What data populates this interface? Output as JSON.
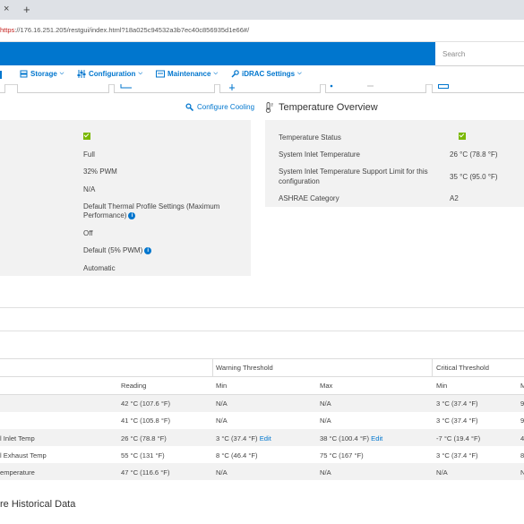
{
  "browser": {
    "tab_close": "×",
    "new_tab": "+",
    "url_protocol": "https",
    "url_rest": "://176.16.251.205/restgui/index.html?18a025c94532a3b7ec40c856935d1e66#/"
  },
  "header": {
    "search_placeholder": "Search"
  },
  "nav": {
    "items": [
      {
        "label": "Storage"
      },
      {
        "label": "Configuration"
      },
      {
        "label": "Maintenance"
      },
      {
        "label": "iDRAC Settings"
      }
    ]
  },
  "cooling": {
    "configure_label": "Configure Cooling",
    "values": {
      "status": "",
      "fan_speed": "Full",
      "pwm": "32% PWM",
      "na": "N/A",
      "profile_line1": "Default Thermal Profile Settings (Maximum",
      "profile_line2": "Performance)",
      "off": "Off",
      "default_pwm": "Default (5% PWM)",
      "automatic": "Automatic"
    }
  },
  "temperature_overview": {
    "title": "Temperature Overview",
    "rows": [
      {
        "label": "Temperature Status",
        "value": ""
      },
      {
        "label": "System Inlet Temperature",
        "value": "26 °C (78.8 °F)"
      },
      {
        "label_line1": "System Inlet Temperature Support Limit for this",
        "label_line2": "configuration",
        "value": "35 °C (95.0 °F)"
      },
      {
        "label": "ASHRAE Category",
        "value": "A2"
      }
    ]
  },
  "table": {
    "group_headers": {
      "warning": "Warning Threshold",
      "critical": "Critical Threshold"
    },
    "columns": {
      "reading": "Reading",
      "warn_min": "Min",
      "warn_max": "Max",
      "crit_min": "Min",
      "crit_max_partial": "M"
    },
    "edit_label": "Edit",
    "rows": [
      {
        "name": "",
        "reading": "42 °C (107.6 °F)",
        "warn_min": "N/A",
        "warn_max": "N/A",
        "crit_min": "3 °C (37.4 °F)",
        "crit_max": "9"
      },
      {
        "name": "",
        "reading": "41 °C (105.8 °F)",
        "warn_min": "N/A",
        "warn_max": "N/A",
        "crit_min": "3 °C (37.4 °F)",
        "crit_max": "9"
      },
      {
        "name": "l Inlet Temp",
        "reading": "26 °C (78.8 °F)",
        "warn_min": "3 °C (37.4 °F)",
        "warn_max": "38 °C (100.4 °F)",
        "crit_min": "-7 °C (19.4 °F)",
        "crit_max": "4"
      },
      {
        "name": "l Exhaust Temp",
        "reading": "55 °C (131 °F)",
        "warn_min": "8 °C (46.4 °F)",
        "warn_max": "75 °C (167 °F)",
        "crit_min": "3 °C (37.4 °F)",
        "crit_max": "8"
      },
      {
        "name": "emperature",
        "reading": "47 °C (116.6 °F)",
        "warn_min": "N/A",
        "warn_max": "N/A",
        "crit_min": "N/A",
        "crit_max": "N"
      }
    ]
  },
  "historical": {
    "title": "re Historical Data"
  },
  "colors": {
    "brand_blue": "#0076ce",
    "status_green": "#7ab800",
    "panel_gray": "#f2f2f2"
  }
}
